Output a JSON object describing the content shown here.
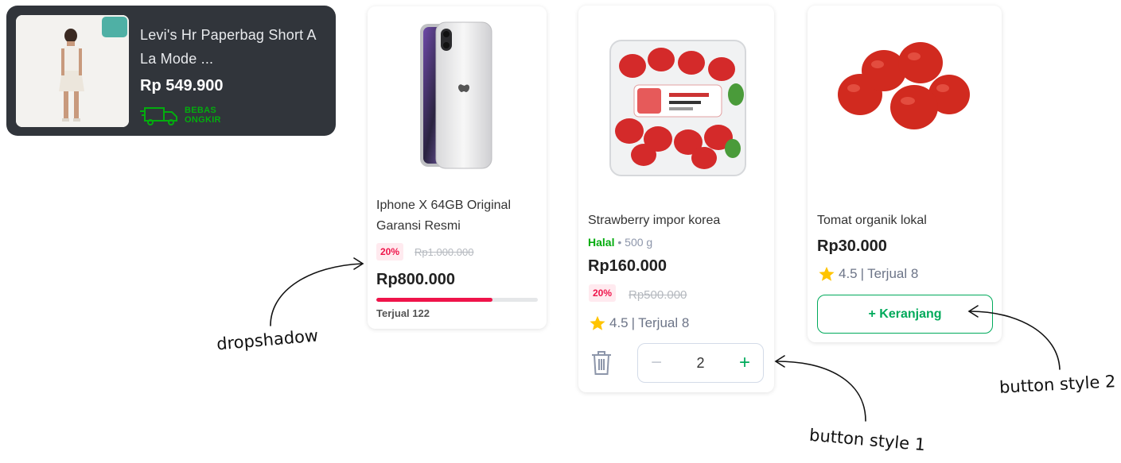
{
  "dark_card": {
    "title": "Levi's Hr Paperbag Short A La Mode ...",
    "price": "Rp 549.900",
    "shipping_line1": "BEBAS",
    "shipping_line2": "ONGKIR"
  },
  "card1": {
    "name": "Iphone X 64GB Original Garansi Resmi",
    "discount": "20%",
    "original_price": "Rp1.000.000",
    "price": "Rp800.000",
    "sold_label": "Terjual 122",
    "sold_progress": 0.72
  },
  "card2": {
    "name": "Strawberry impor korea",
    "halal": "Halal",
    "separator": "•",
    "weight": "500 g",
    "price": "Rp160.000",
    "discount": "20%",
    "original_price": "Rp500.000",
    "rating": "4.5",
    "sold": "Terjual 8",
    "quantity": "2",
    "minus": "−",
    "plus": "+"
  },
  "card3": {
    "name": "Tomat organik lokal",
    "price": "Rp30.000",
    "rating": "4.5",
    "sold": "Terjual 8",
    "button_label": "+ Keranjang"
  },
  "annotations": {
    "dropshadow": "dropshadow",
    "button_style_1": "button style 1",
    "button_style_2": "button style 2"
  },
  "colors": {
    "accent_green": "#00aa5b",
    "discount_red": "#ef144a",
    "dark_card_bg": "#31353b",
    "star": "#ffc400"
  },
  "icons": [
    "truck-icon",
    "star-icon",
    "trash-icon",
    "minus-icon",
    "plus-icon",
    "arrow-icon"
  ]
}
